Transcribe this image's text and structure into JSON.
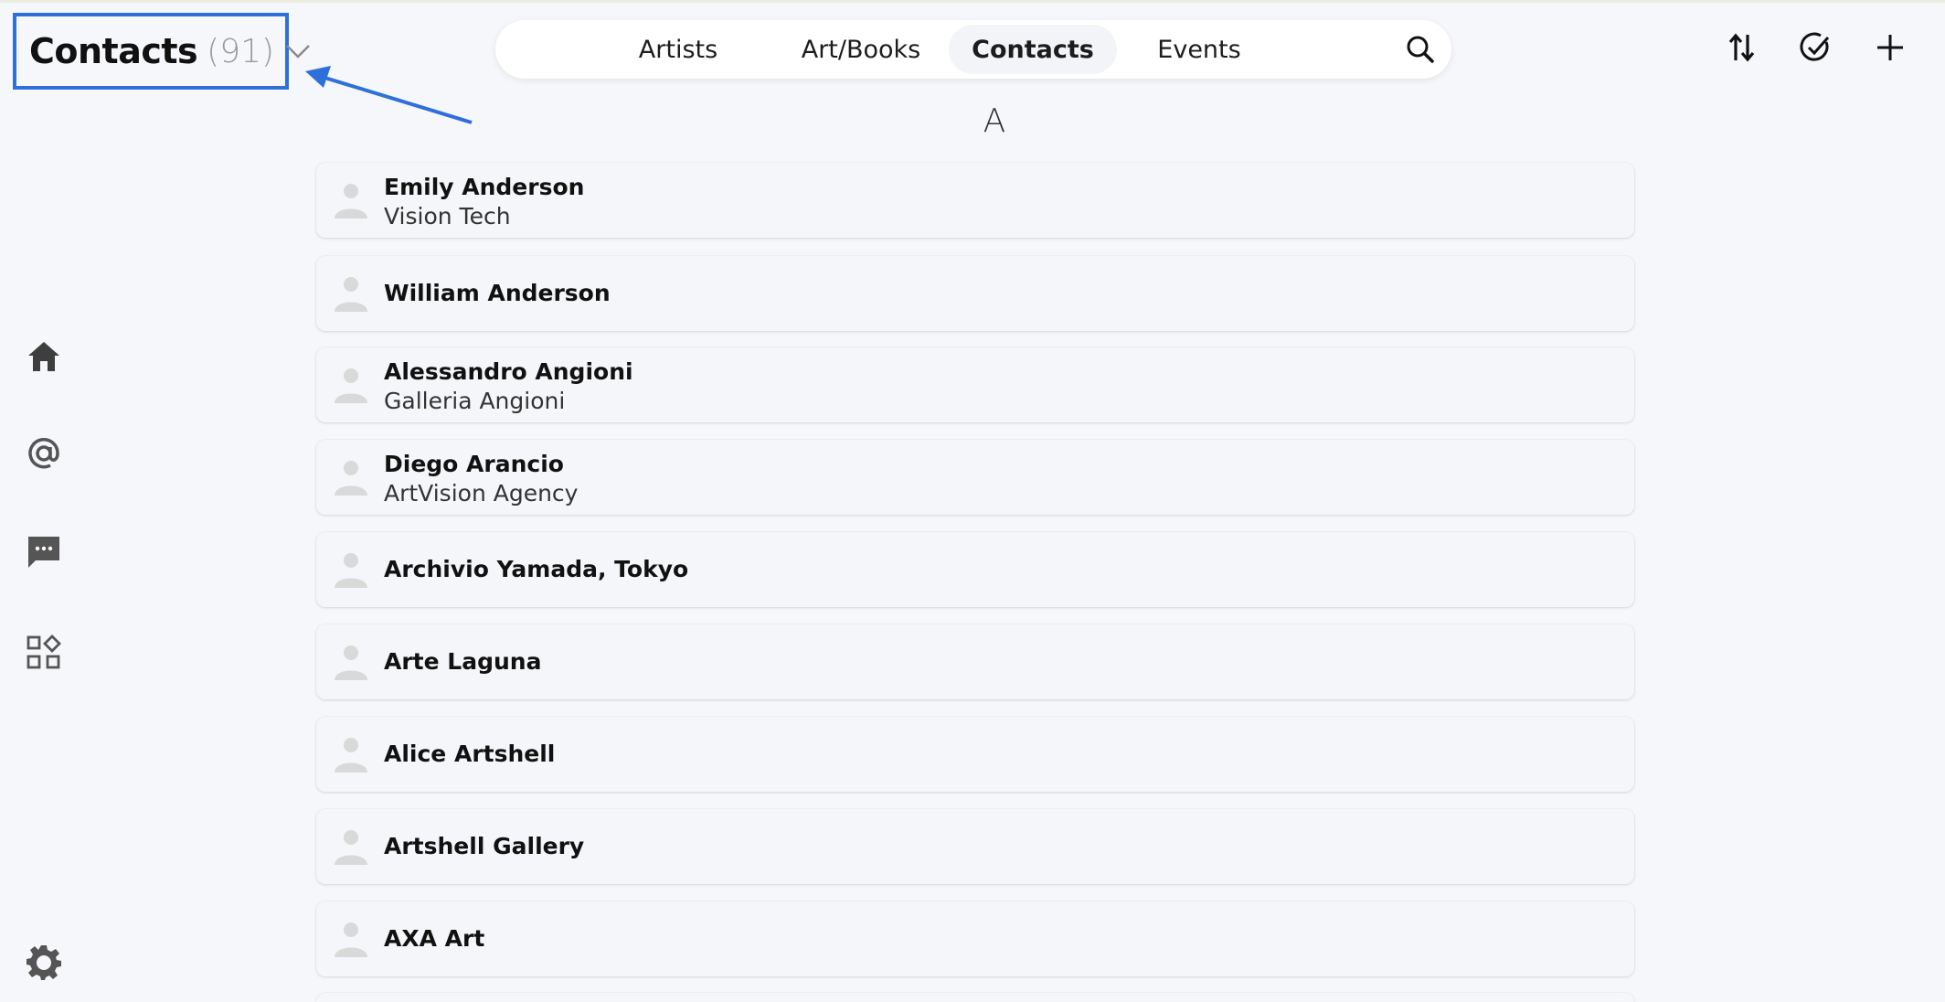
{
  "header": {
    "title": "Contacts",
    "count": "(91)"
  },
  "tabs": [
    {
      "label": "Artists",
      "active": false
    },
    {
      "label": "Art/Books",
      "active": false
    },
    {
      "label": "Contacts",
      "active": true
    },
    {
      "label": "Events",
      "active": false
    }
  ],
  "toolbar_icons": [
    "sort-icon",
    "select-check-icon",
    "add-icon"
  ],
  "sidebar_icons": [
    "home-icon",
    "at-mention-icon",
    "chat-icon",
    "apps-icon",
    "settings-icon"
  ],
  "section_letter": "A",
  "contacts": [
    {
      "name": "Emily Anderson",
      "org": "Vision Tech"
    },
    {
      "name": "William Anderson",
      "org": ""
    },
    {
      "name": "Alessandro Angioni",
      "org": "Galleria Angioni"
    },
    {
      "name": "Diego Arancio",
      "org": "ArtVision Agency"
    },
    {
      "name": "Archivio Yamada, Tokyo",
      "org": ""
    },
    {
      "name": "Arte Laguna",
      "org": ""
    },
    {
      "name": "Alice Artshell",
      "org": ""
    },
    {
      "name": "Artshell Gallery",
      "org": ""
    },
    {
      "name": "AXA Art",
      "org": ""
    }
  ],
  "colors": {
    "accent": "#2f6fdc",
    "background": "#f6f7fa",
    "icon": "#555555",
    "avatar": "#d8d8d8"
  }
}
